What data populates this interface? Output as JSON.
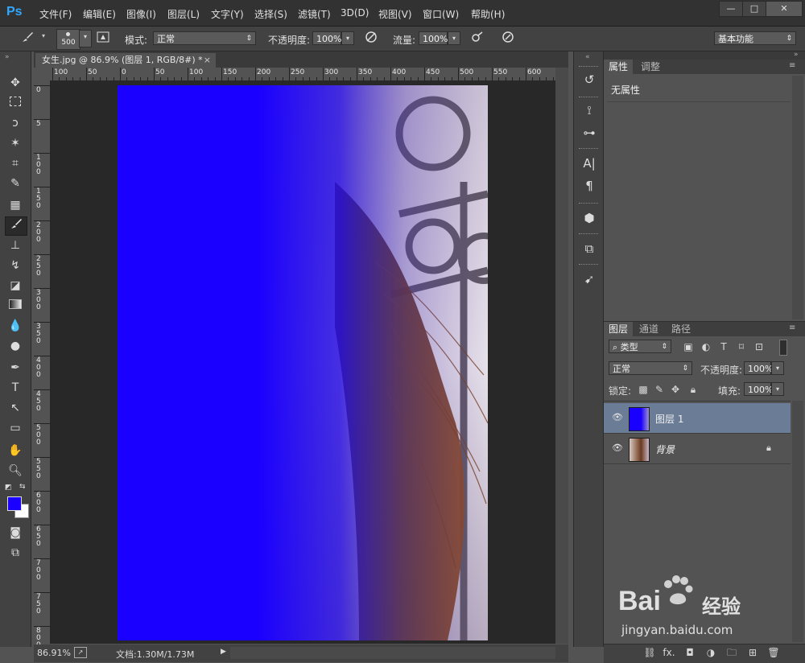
{
  "app": {
    "logo": "Ps"
  },
  "menu": [
    "文件(F)",
    "编辑(E)",
    "图像(I)",
    "图层(L)",
    "文字(Y)",
    "选择(S)",
    "滤镜(T)",
    "3D(D)",
    "视图(V)",
    "窗口(W)",
    "帮助(H)"
  ],
  "window_controls": {
    "minimize": "—",
    "maximize": "□",
    "close": "✕"
  },
  "options": {
    "brush_size": "500",
    "mode_label": "模式:",
    "mode_value": "正常",
    "opacity_label": "不透明度:",
    "opacity_value": "100%",
    "flow_label": "流量:",
    "flow_value": "100%",
    "workspace": "基本功能"
  },
  "document": {
    "tab_title": "女生.jpg @ 86.9% (图层 1, RGB/8#) *",
    "tab_close": "×",
    "ruler_h_labels": [
      "100",
      "50",
      "0",
      "50",
      "100",
      "150",
      "200",
      "250",
      "300",
      "350",
      "400",
      "450",
      "500",
      "550",
      "600"
    ],
    "ruler_v_labels": [
      "0",
      "5",
      "1\n0\n0",
      "1\n5\n0",
      "2\n0\n0",
      "2\n5\n0",
      "3\n0\n0",
      "3\n5\n0",
      "4\n0\n0",
      "4\n5\n0",
      "5\n0\n0",
      "5\n5\n0",
      "6\n0\n0",
      "6\n5\n0",
      "7\n0\n0",
      "7\n5\n0",
      "8\n0\n0"
    ],
    "zoom": "86.91%",
    "doc_info": "文档:1.30M/1.73M"
  },
  "colors": {
    "foreground": "#1a00ff",
    "background": "#ffffff",
    "panel_bg": "#535353",
    "selected_layer": "#6b7d96"
  },
  "properties_panel": {
    "tabs": [
      "属性",
      "调整"
    ],
    "content": "无属性"
  },
  "layers_panel": {
    "tabs": [
      "图层",
      "通道",
      "路径"
    ],
    "filter_label": "类型",
    "blend_mode": "正常",
    "opacity_label": "不透明度:",
    "opacity_value": "100%",
    "lock_label": "锁定:",
    "fill_label": "填充:",
    "fill_value": "100%",
    "layers": [
      {
        "name": "图层 1",
        "selected": true
      },
      {
        "name": "背景",
        "selected": false,
        "locked": true
      }
    ],
    "bottom_icons": [
      "link-icon",
      "fx-icon",
      "mask-icon",
      "adjustment-icon",
      "group-icon",
      "new-layer-icon",
      "trash-icon"
    ],
    "bottom_fx": "fx."
  },
  "watermark": {
    "brand_latin": "Bai",
    "brand_han": "经验",
    "url": "jingyan.baidu.com"
  }
}
